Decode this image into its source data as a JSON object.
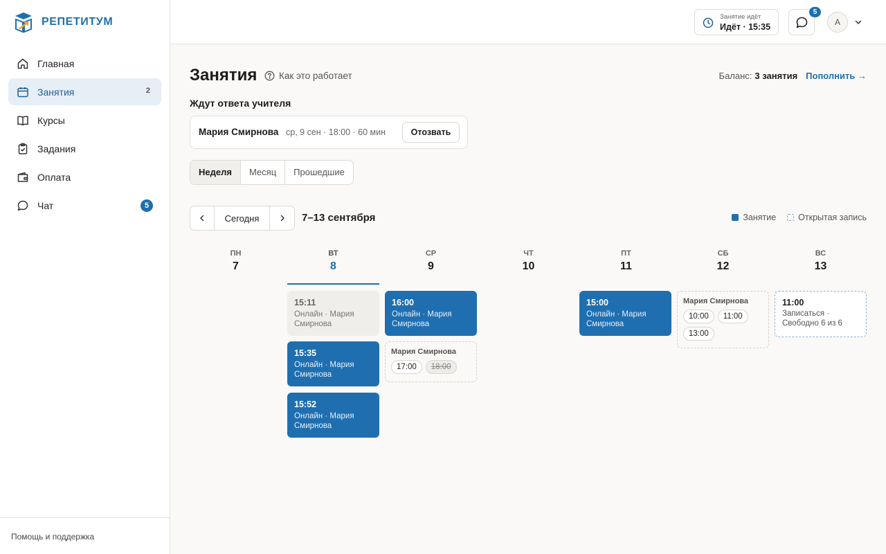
{
  "app": {
    "name": "РЕПЕТИТУМ"
  },
  "sidebar": {
    "items": [
      {
        "label": "Главная",
        "icon": "home-icon"
      },
      {
        "label": "Занятия",
        "icon": "calendar-icon",
        "badge": "2",
        "active": true
      },
      {
        "label": "Курсы",
        "icon": "book-icon"
      },
      {
        "label": "Задания",
        "icon": "clipboard-icon"
      },
      {
        "label": "Оплата",
        "icon": "wallet-icon"
      },
      {
        "label": "Чат",
        "icon": "chat-icon",
        "badge": "5"
      }
    ],
    "footer": "Помощь и поддержка"
  },
  "topbar": {
    "session_label": "Занятие идёт",
    "session_value": "Идёт · 15:35",
    "chat_badge": "5",
    "avatar_initial": "А"
  },
  "page": {
    "title": "Занятия",
    "how_link": "Как это работает",
    "balance_label": "Баланс:",
    "balance_value": "3 занятия",
    "topup_label": "Пополнить →"
  },
  "waiting": {
    "heading": "Ждут ответа учителя",
    "items": [
      {
        "name": "Мария Смирнова",
        "meta": "ср, 9 сен · 18:00 · 60 мин",
        "action": "Отозвать"
      }
    ]
  },
  "view_tabs": [
    {
      "label": "Неделя",
      "active": true
    },
    {
      "label": "Месяц"
    },
    {
      "label": "Прошедшие"
    }
  ],
  "calendar": {
    "today_label": "Сегодня",
    "range": "7–13 сентября",
    "legend": {
      "lesson": "Занятие",
      "open": "Открытая запись"
    },
    "days": [
      {
        "name": "ПН",
        "num": "7"
      },
      {
        "name": "ВТ",
        "num": "8",
        "today": true
      },
      {
        "name": "СР",
        "num": "9"
      },
      {
        "name": "ЧТ",
        "num": "10"
      },
      {
        "name": "ПТ",
        "num": "11"
      },
      {
        "name": "СБ",
        "num": "12"
      },
      {
        "name": "ВС",
        "num": "13"
      }
    ],
    "events": [
      {
        "time": "15:11",
        "sub": "Онлайн · Мария Смирнова",
        "state": "past"
      },
      {
        "time": "15:35",
        "sub": "Онлайн · Мария Смирнова",
        "state": "booked"
      },
      {
        "time": "15:52",
        "sub": "Онлайн · Мария Смирнова",
        "state": "booked"
      },
      {
        "time": "16:00",
        "sub": "Онлайн · Мария Смирнова",
        "state": "booked"
      },
      {
        "time": "15:00",
        "sub": "Онлайн · Мария Смирнова",
        "state": "booked"
      }
    ],
    "slot_groups": [
      {
        "name": "Мария Смирнова",
        "slots": [
          {
            "time": "17:00"
          },
          {
            "time": "18:00",
            "taken": true
          }
        ]
      },
      {
        "name": "Мария Смирнова",
        "slots": [
          {
            "time": "10:00"
          },
          {
            "time": "11:00"
          },
          {
            "time": "13:00"
          }
        ]
      }
    ],
    "open_booking": {
      "time": "11:00",
      "sub": "Записаться · Свободно 6 из 6"
    }
  }
}
